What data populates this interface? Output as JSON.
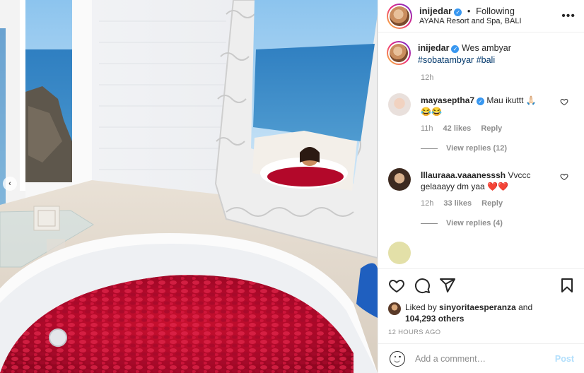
{
  "photo": {
    "nav_prev": "‹"
  },
  "header": {
    "username": "inijedar",
    "separator": "•",
    "follow_status": "Following",
    "location": "AYANA Resort and Spa, BALI",
    "more": "•••"
  },
  "caption": {
    "username": "inijedar",
    "text": "Wes ambyar",
    "hashtags": [
      "#sobatambyar",
      "#bali"
    ],
    "time": "12h"
  },
  "comments": [
    {
      "username": "mayaseptha7",
      "verified": true,
      "text": "Mau ikuttt 🙏🏻",
      "emoji_line": "😂😂",
      "time": "11h",
      "likes": "42 likes",
      "reply": "Reply",
      "view_replies": "View replies (12)"
    },
    {
      "username": "lllauraaa.vaaanesssh",
      "verified": false,
      "text": "Vvccc gelaaayy dm yaa",
      "emoji_line": "❤️❤️",
      "time": "12h",
      "likes": "33 likes",
      "reply": "Reply",
      "view_replies": "View replies (4)"
    }
  ],
  "actions": {
    "liked_by_prefix": "Liked by",
    "liked_by_user": "sinyoritaesperanza",
    "liked_by_and": "and",
    "others_count": "104,293 others",
    "timestamp": "12 HOURS AGO"
  },
  "add_comment": {
    "placeholder": "Add a comment…",
    "post_label": "Post"
  },
  "colors": {
    "verified": "#3897f0",
    "link": "#00376b",
    "meta": "#8e8e8e",
    "post_disabled": "#b2dffc",
    "heart": "#ed4956"
  }
}
